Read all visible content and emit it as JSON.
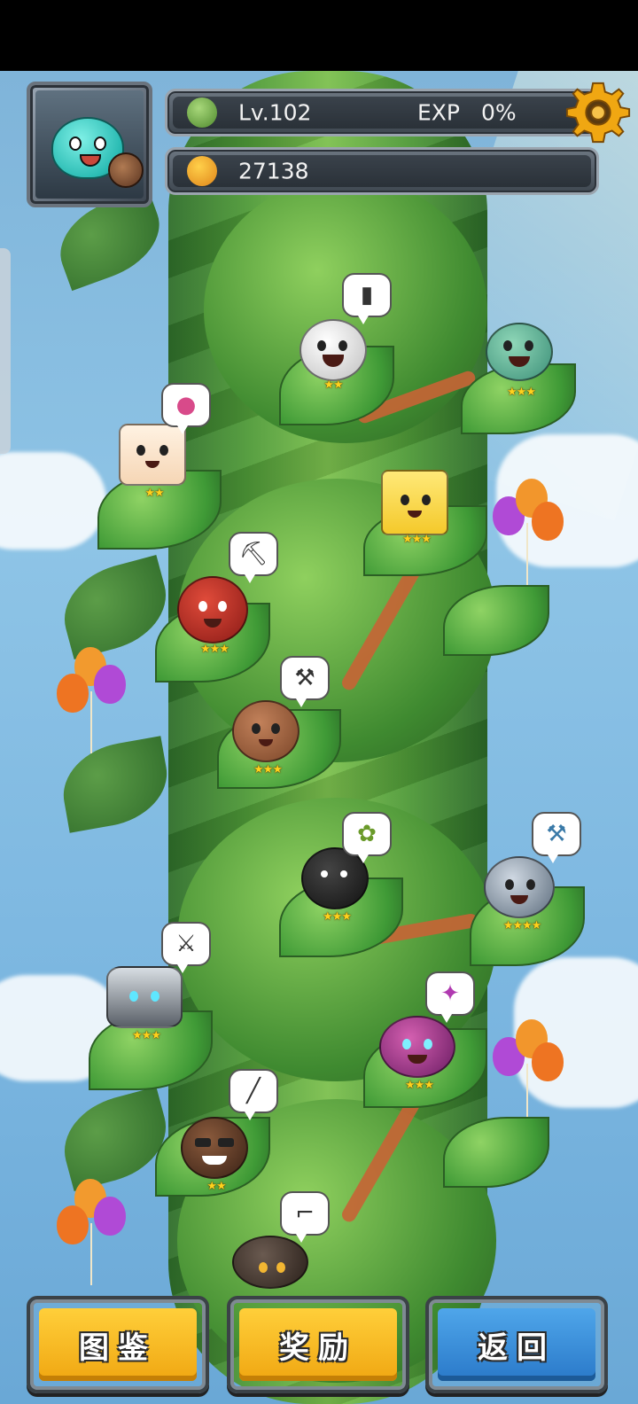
{
  "player": {
    "level": "Lv.102",
    "exp_label": "EXP",
    "exp_value": "0%",
    "currency": "27138"
  },
  "icons": {
    "level": "tree-level-icon",
    "currency": "fruit-currency-icon",
    "settings": "gear-icon"
  },
  "characters": [
    {
      "name": "white-egg-character",
      "stars": "★★",
      "item": "bottle-icon"
    },
    {
      "name": "zombie-warrior-character",
      "stars": "★★★",
      "item": ""
    },
    {
      "name": "pink-box-character",
      "stars": "★★",
      "item": "dango-icon"
    },
    {
      "name": "yellow-box-character",
      "stars": "★★★",
      "item": ""
    },
    {
      "name": "red-hood-character",
      "stars": "★★★",
      "item": "pickaxe-icon"
    },
    {
      "name": "brown-seed-character",
      "stars": "★★★",
      "item": "tool-icon"
    },
    {
      "name": "black-tophat-character",
      "stars": "★★★",
      "item": "sprout-icon"
    },
    {
      "name": "cyber-robot-character",
      "stars": "★★★★",
      "item": "hammer-icon"
    },
    {
      "name": "dark-knight-character",
      "stars": "★★★",
      "item": "sword-icon"
    },
    {
      "name": "dragon-character",
      "stars": "★★★",
      "item": "crystal-staff-icon"
    },
    {
      "name": "sunglasses-character",
      "stars": "★★",
      "item": "knife-icon"
    },
    {
      "name": "armored-character",
      "stars": "",
      "item": "pipe-icon"
    }
  ],
  "buttons": {
    "collection": "图鉴",
    "rewards": "奖励",
    "back": "返回"
  },
  "colors": {
    "accent_yellow": "#f0a712",
    "accent_blue": "#2a79c9",
    "star": "#ffd21c"
  }
}
